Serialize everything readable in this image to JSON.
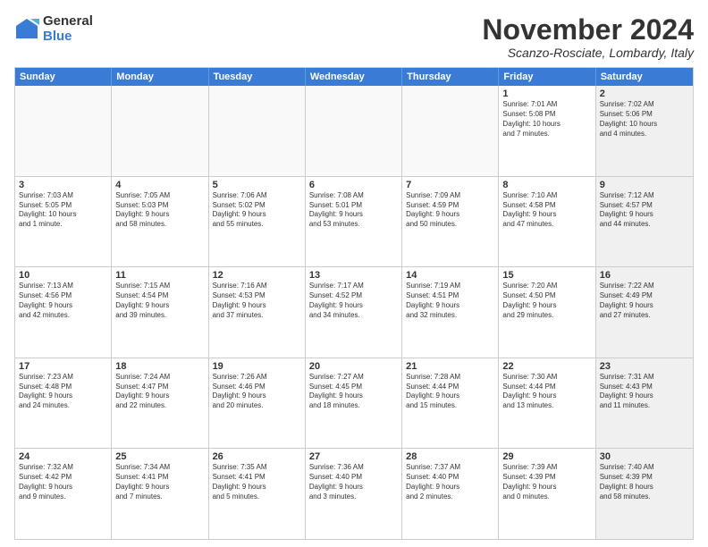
{
  "logo": {
    "general": "General",
    "blue": "Blue"
  },
  "title": "November 2024",
  "location": "Scanzo-Rosciate, Lombardy, Italy",
  "header": {
    "days": [
      "Sunday",
      "Monday",
      "Tuesday",
      "Wednesday",
      "Thursday",
      "Friday",
      "Saturday"
    ]
  },
  "rows": [
    [
      {
        "num": "",
        "empty": true
      },
      {
        "num": "",
        "empty": true
      },
      {
        "num": "",
        "empty": true
      },
      {
        "num": "",
        "empty": true
      },
      {
        "num": "",
        "empty": true
      },
      {
        "num": "1",
        "text": "Sunrise: 7:01 AM\nSunset: 5:08 PM\nDaylight: 10 hours\nand 7 minutes.",
        "shaded": false
      },
      {
        "num": "2",
        "text": "Sunrise: 7:02 AM\nSunset: 5:06 PM\nDaylight: 10 hours\nand 4 minutes.",
        "shaded": true
      }
    ],
    [
      {
        "num": "3",
        "text": "Sunrise: 7:03 AM\nSunset: 5:05 PM\nDaylight: 10 hours\nand 1 minute.",
        "shaded": false
      },
      {
        "num": "4",
        "text": "Sunrise: 7:05 AM\nSunset: 5:03 PM\nDaylight: 9 hours\nand 58 minutes.",
        "shaded": false
      },
      {
        "num": "5",
        "text": "Sunrise: 7:06 AM\nSunset: 5:02 PM\nDaylight: 9 hours\nand 55 minutes.",
        "shaded": false
      },
      {
        "num": "6",
        "text": "Sunrise: 7:08 AM\nSunset: 5:01 PM\nDaylight: 9 hours\nand 53 minutes.",
        "shaded": false
      },
      {
        "num": "7",
        "text": "Sunrise: 7:09 AM\nSunset: 4:59 PM\nDaylight: 9 hours\nand 50 minutes.",
        "shaded": false
      },
      {
        "num": "8",
        "text": "Sunrise: 7:10 AM\nSunset: 4:58 PM\nDaylight: 9 hours\nand 47 minutes.",
        "shaded": false
      },
      {
        "num": "9",
        "text": "Sunrise: 7:12 AM\nSunset: 4:57 PM\nDaylight: 9 hours\nand 44 minutes.",
        "shaded": true
      }
    ],
    [
      {
        "num": "10",
        "text": "Sunrise: 7:13 AM\nSunset: 4:56 PM\nDaylight: 9 hours\nand 42 minutes.",
        "shaded": false
      },
      {
        "num": "11",
        "text": "Sunrise: 7:15 AM\nSunset: 4:54 PM\nDaylight: 9 hours\nand 39 minutes.",
        "shaded": false
      },
      {
        "num": "12",
        "text": "Sunrise: 7:16 AM\nSunset: 4:53 PM\nDaylight: 9 hours\nand 37 minutes.",
        "shaded": false
      },
      {
        "num": "13",
        "text": "Sunrise: 7:17 AM\nSunset: 4:52 PM\nDaylight: 9 hours\nand 34 minutes.",
        "shaded": false
      },
      {
        "num": "14",
        "text": "Sunrise: 7:19 AM\nSunset: 4:51 PM\nDaylight: 9 hours\nand 32 minutes.",
        "shaded": false
      },
      {
        "num": "15",
        "text": "Sunrise: 7:20 AM\nSunset: 4:50 PM\nDaylight: 9 hours\nand 29 minutes.",
        "shaded": false
      },
      {
        "num": "16",
        "text": "Sunrise: 7:22 AM\nSunset: 4:49 PM\nDaylight: 9 hours\nand 27 minutes.",
        "shaded": true
      }
    ],
    [
      {
        "num": "17",
        "text": "Sunrise: 7:23 AM\nSunset: 4:48 PM\nDaylight: 9 hours\nand 24 minutes.",
        "shaded": false
      },
      {
        "num": "18",
        "text": "Sunrise: 7:24 AM\nSunset: 4:47 PM\nDaylight: 9 hours\nand 22 minutes.",
        "shaded": false
      },
      {
        "num": "19",
        "text": "Sunrise: 7:26 AM\nSunset: 4:46 PM\nDaylight: 9 hours\nand 20 minutes.",
        "shaded": false
      },
      {
        "num": "20",
        "text": "Sunrise: 7:27 AM\nSunset: 4:45 PM\nDaylight: 9 hours\nand 18 minutes.",
        "shaded": false
      },
      {
        "num": "21",
        "text": "Sunrise: 7:28 AM\nSunset: 4:44 PM\nDaylight: 9 hours\nand 15 minutes.",
        "shaded": false
      },
      {
        "num": "22",
        "text": "Sunrise: 7:30 AM\nSunset: 4:44 PM\nDaylight: 9 hours\nand 13 minutes.",
        "shaded": false
      },
      {
        "num": "23",
        "text": "Sunrise: 7:31 AM\nSunset: 4:43 PM\nDaylight: 9 hours\nand 11 minutes.",
        "shaded": true
      }
    ],
    [
      {
        "num": "24",
        "text": "Sunrise: 7:32 AM\nSunset: 4:42 PM\nDaylight: 9 hours\nand 9 minutes.",
        "shaded": false
      },
      {
        "num": "25",
        "text": "Sunrise: 7:34 AM\nSunset: 4:41 PM\nDaylight: 9 hours\nand 7 minutes.",
        "shaded": false
      },
      {
        "num": "26",
        "text": "Sunrise: 7:35 AM\nSunset: 4:41 PM\nDaylight: 9 hours\nand 5 minutes.",
        "shaded": false
      },
      {
        "num": "27",
        "text": "Sunrise: 7:36 AM\nSunset: 4:40 PM\nDaylight: 9 hours\nand 3 minutes.",
        "shaded": false
      },
      {
        "num": "28",
        "text": "Sunrise: 7:37 AM\nSunset: 4:40 PM\nDaylight: 9 hours\nand 2 minutes.",
        "shaded": false
      },
      {
        "num": "29",
        "text": "Sunrise: 7:39 AM\nSunset: 4:39 PM\nDaylight: 9 hours\nand 0 minutes.",
        "shaded": false
      },
      {
        "num": "30",
        "text": "Sunrise: 7:40 AM\nSunset: 4:39 PM\nDaylight: 8 hours\nand 58 minutes.",
        "shaded": true
      }
    ]
  ]
}
